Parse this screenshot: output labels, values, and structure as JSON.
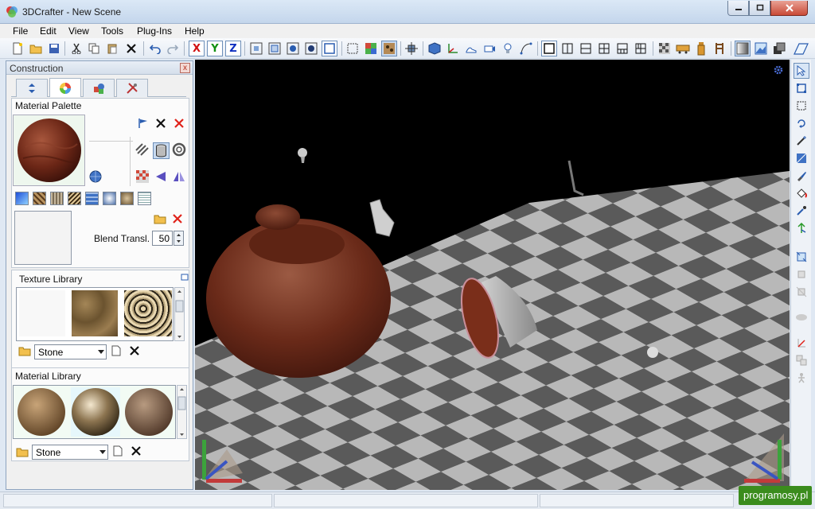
{
  "window": {
    "title": "3DCrafter - New Scene"
  },
  "menu": {
    "items": [
      "File",
      "Edit",
      "View",
      "Tools",
      "Plug-Ins",
      "Help"
    ]
  },
  "toolbar": {
    "axes": {
      "x": "X",
      "y": "Y",
      "z": "Z"
    },
    "axis_colors": {
      "x": "#d01010",
      "y": "#109010",
      "z": "#1030c0"
    },
    "icons": [
      "new-icon",
      "open-icon",
      "save-icon",
      "cut-icon",
      "copy-icon",
      "paste-icon",
      "delete-icon",
      "undo-icon",
      "redo-icon",
      "axis-x",
      "axis-y",
      "axis-z",
      "zoom-extents-icon",
      "zoom-selected-icon",
      "orbit-icon",
      "pan-icon",
      "fit-icon",
      "select-all-icon",
      "texture-icon",
      "material-icon",
      "snap-icon",
      "cube-icon",
      "axes-icon",
      "shoe-icon",
      "camera-icon",
      "light-icon",
      "path-icon",
      "single-view-icon",
      "two-view-icon",
      "split-view-icon",
      "four-view-icon",
      "three-view-icon",
      "quad-view-icon",
      "checker-icon",
      "train-icon",
      "bottle-icon",
      "chair-icon",
      "shading-icon",
      "picture-icon",
      "layers-icon",
      "sidebar-icon"
    ]
  },
  "panel": {
    "title": "Construction",
    "close_label": "x",
    "tabs": [
      "transform",
      "material",
      "objects",
      "tools"
    ],
    "material_palette": {
      "label": "Material Palette"
    },
    "blend": {
      "label": "Blend Transl.",
      "value": "50"
    },
    "texture_library": {
      "label": "Texture Library",
      "category": "Stone"
    },
    "material_library": {
      "label": "Material Library",
      "category": "Stone"
    }
  },
  "statusbar": {
    "panes": [
      "",
      "",
      ""
    ]
  },
  "watermark": "programosy.pl"
}
